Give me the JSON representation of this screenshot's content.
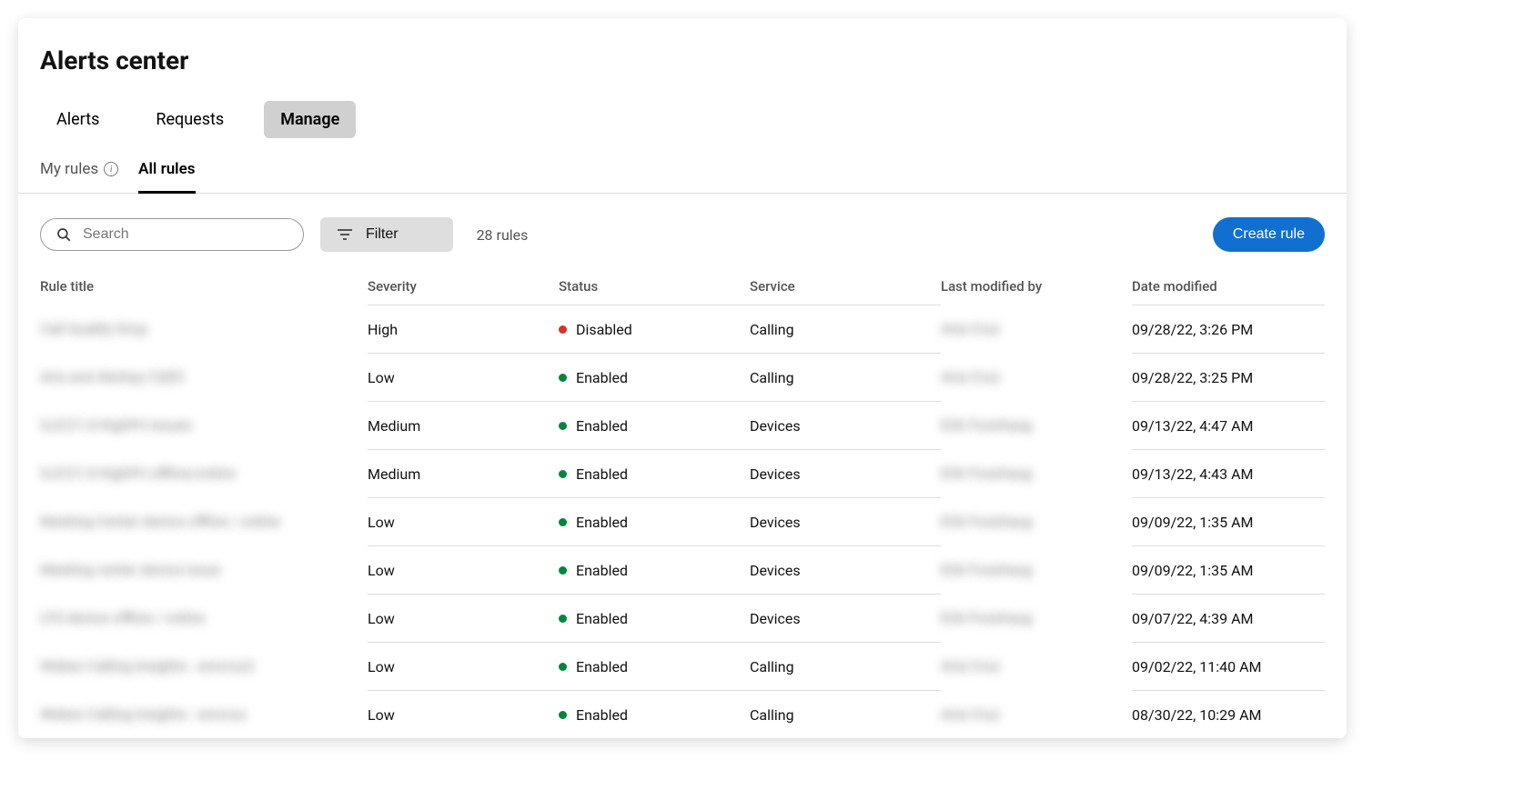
{
  "page": {
    "title": "Alerts center"
  },
  "primary_tabs": [
    {
      "label": "Alerts",
      "active": false
    },
    {
      "label": "Requests",
      "active": false
    },
    {
      "label": "Manage",
      "active": true
    }
  ],
  "sub_tabs": [
    {
      "label": "My rules",
      "active": false,
      "has_info": true
    },
    {
      "label": "All rules",
      "active": true,
      "has_info": false
    }
  ],
  "toolbar": {
    "search_placeholder": "Search",
    "filter_label": "Filter",
    "rule_count": "28 rules",
    "create_label": "Create rule"
  },
  "table": {
    "headers": {
      "title": "Rule title",
      "severity": "Severity",
      "status": "Status",
      "service": "Service",
      "modified_by": "Last modified by",
      "date_modified": "Date modified"
    },
    "rows": [
      {
        "title_hidden": "Call Quality Drop",
        "severity": "High",
        "status": "Disabled",
        "status_color": "red",
        "service": "Calling",
        "modified_by_hidden": "Aria Cruz",
        "date": "09/28/22, 3:26 PM"
      },
      {
        "title_hidden": "Aris and Akshay CQES",
        "severity": "Low",
        "status": "Enabled",
        "status_color": "green",
        "service": "Calling",
        "modified_by_hidden": "Aria Cruz",
        "date": "09/28/22, 3:25 PM"
      },
      {
        "title_hidden": "SJC21-3-HighPri issues",
        "severity": "Medium",
        "status": "Enabled",
        "status_color": "green",
        "service": "Devices",
        "modified_by_hidden": "Erik Fosshaug",
        "date": "09/13/22, 4:47 AM"
      },
      {
        "title_hidden": "SJC21-3-HighPri offline/online",
        "severity": "Medium",
        "status": "Enabled",
        "status_color": "green",
        "service": "Devices",
        "modified_by_hidden": "Erik Fosshaug",
        "date": "09/13/22, 4:43 AM"
      },
      {
        "title_hidden": "Meeting Center device offline / online",
        "severity": "Low",
        "status": "Enabled",
        "status_color": "green",
        "service": "Devices",
        "modified_by_hidden": "Erik Fosshaug",
        "date": "09/09/22, 1:35 AM"
      },
      {
        "title_hidden": "Meeting center device issue",
        "severity": "Low",
        "status": "Enabled",
        "status_color": "green",
        "service": "Devices",
        "modified_by_hidden": "Erik Fosshaug",
        "date": "09/09/22, 1:35 AM"
      },
      {
        "title_hidden": "LYS device offline / online",
        "severity": "Low",
        "status": "Enabled",
        "status_color": "green",
        "service": "Devices",
        "modified_by_hidden": "Erik Fosshaug",
        "date": "09/07/22, 4:39 AM"
      },
      {
        "title_hidden": "Webex Calling Insights - amcruz2",
        "severity": "Low",
        "status": "Enabled",
        "status_color": "green",
        "service": "Calling",
        "modified_by_hidden": "Aria Cruz",
        "date": "09/02/22, 11:40 AM"
      },
      {
        "title_hidden": "Webex Calling Insights - amcruz",
        "severity": "Low",
        "status": "Enabled",
        "status_color": "green",
        "service": "Calling",
        "modified_by_hidden": "Aria Cruz",
        "date": "08/30/22, 10:29 AM"
      }
    ]
  }
}
